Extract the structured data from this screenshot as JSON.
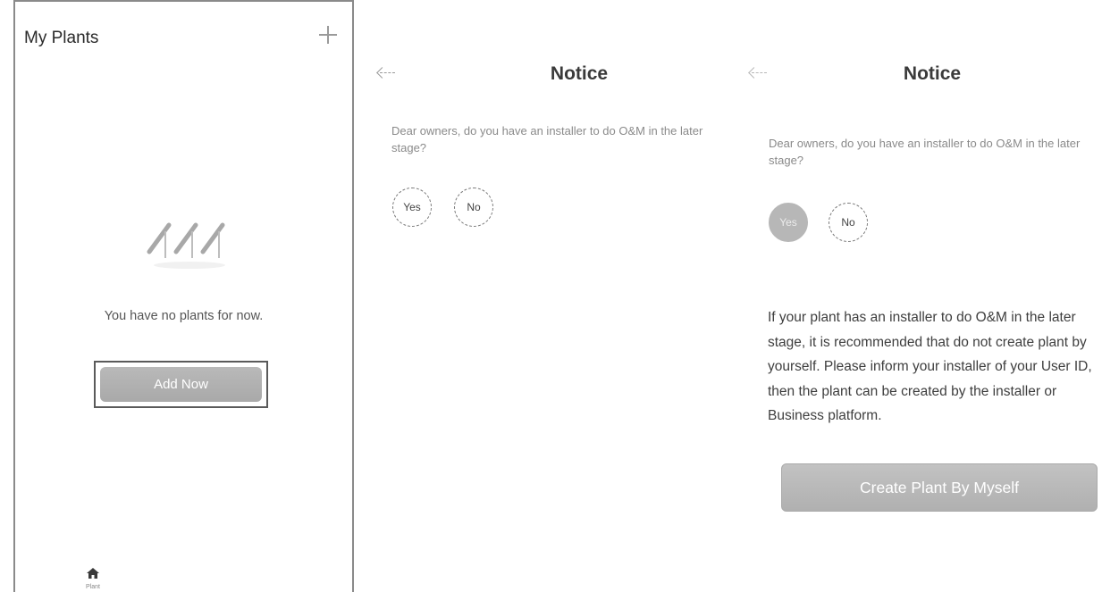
{
  "my_plants": {
    "title": "My Plants",
    "empty_text": "You have no plants for now.",
    "add_button": "Add Now",
    "tab_label": "Plant"
  },
  "notice_step1": {
    "title": "Notice",
    "question": "Dear owners, do you have an installer to do O&M in the later stage?",
    "yes": "Yes",
    "no": "No"
  },
  "notice_step2": {
    "title": "Notice",
    "question": "Dear owners, do you have an installer to do O&M in the later stage?",
    "yes": "Yes",
    "no": "No",
    "selected": "Yes",
    "info": "If your plant has an installer to do O&M in the later stage, it is recommended that do not create plant by yourself. Please inform your installer of your User ID, then the plant can be created by the installer or Business platform.",
    "create_button": "Create Plant By Myself"
  },
  "icons": {
    "add": "plus-icon",
    "back": "back-arrow-icon",
    "empty": "solar-panel-icon",
    "home": "home-icon"
  }
}
